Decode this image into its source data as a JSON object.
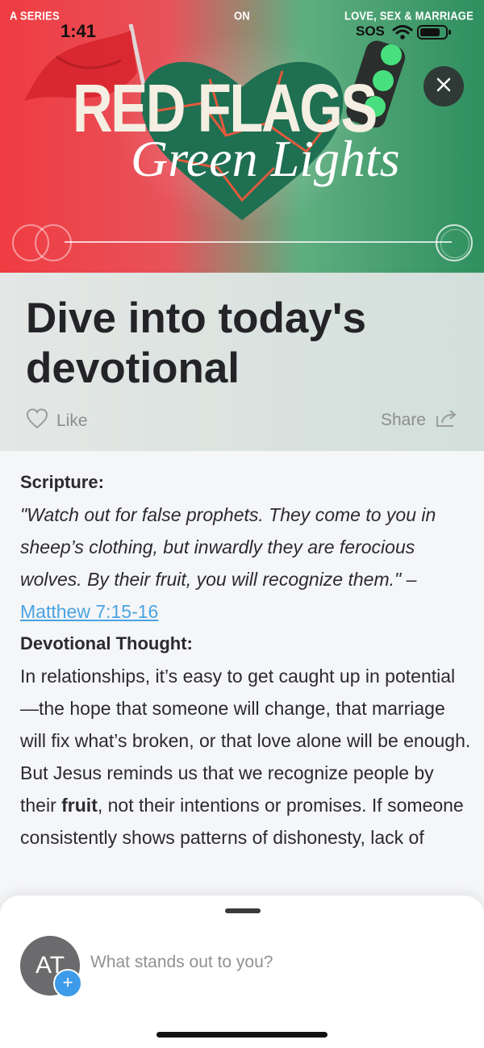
{
  "status_bar": {
    "time": "1:41",
    "carrier": "SOS",
    "icons": [
      "wifi-icon",
      "battery-icon"
    ]
  },
  "hero": {
    "series_left": "A SERIES",
    "series_center": "ON",
    "series_right": "LOVE, SEX & MARRIAGE",
    "title_main": "RED FLAGS",
    "title_script": "Green Lights",
    "close_icon": "close-icon",
    "colors": {
      "red": "#ef3c42",
      "green": "#2f8f5f"
    }
  },
  "header": {
    "title": "Dive into today's devotional",
    "like_label": "Like",
    "share_label": "Share"
  },
  "devotional": {
    "scripture_heading": "Scripture:",
    "scripture_text": "\"Watch out for false prophets. They come to you in sheep’s clothing, but inwardly they are ferocious wolves. By their fruit, you will recognize them.\" –",
    "scripture_ref": "Matthew 7:15-16",
    "thought_heading": "Devotional Thought:",
    "thought_before": "In relationships, it’s easy to get caught up in potential—the hope that someone will change, that marriage will fix what’s broken, or that love alone will be enough. But Jesus reminds us that we recognize people by their",
    "thought_bold": "fruit",
    "thought_after": ", not their intentions or promises. If someone consistently shows patterns of dishonesty, lack of"
  },
  "comment": {
    "avatar_initials": "AT",
    "plus": "+",
    "prompt": "What stands out to you?"
  },
  "theme": {
    "link_color": "#4aa3e0",
    "accent_blue": "#3d9be9"
  }
}
